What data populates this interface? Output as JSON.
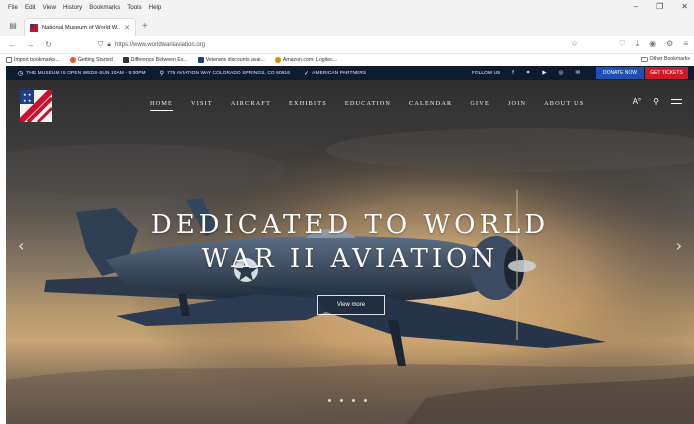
{
  "browser": {
    "menu": [
      "File",
      "Edit",
      "View",
      "History",
      "Bookmarks",
      "Tools",
      "Help"
    ],
    "window_controls": [
      "–",
      "❐",
      "✕"
    ],
    "tab_title": "National Museum of World W...",
    "url": "https://www.worldwariiaviation.org",
    "bookmarks": [
      {
        "label": "Import bookmarks...",
        "color": "#777777"
      },
      {
        "label": "Getting Started",
        "color": "#e8562a"
      },
      {
        "label": "Difference Between Ex...",
        "color": "#333333"
      },
      {
        "label": "Veterans discounts avai...",
        "color": "#1d3f8a"
      },
      {
        "label": "Amazon.com: Logitec...",
        "color": "#e08a00"
      }
    ],
    "other_bookmarks": "Other Bookmarks"
  },
  "site": {
    "info": {
      "hours": "THE MUSEUM IS OPEN WEDS-SUN 10AM - 5:00PM",
      "address": "775 AVIATION WAY COLORADO SPRINGS, CO 80916",
      "affiliate": "AMERICAN PARTNERS",
      "follow": "FOLLOW US",
      "social_icons": [
        "facebook-icon",
        "twitter-icon",
        "youtube-icon",
        "instagram-icon",
        "email-icon"
      ],
      "donate": "DONATE NOW",
      "tickets": "GET TICKETS"
    },
    "nav": [
      "HOME",
      "VISIT",
      "AIRCRAFT",
      "EXHIBITS",
      "EDUCATION",
      "CALENDAR",
      "GIVE",
      "JOIN",
      "ABOUT US"
    ],
    "hero": {
      "line1": "DEDICATED TO WORLD",
      "line2": "WAR II AVIATION",
      "button": "View more",
      "slides": 4
    }
  },
  "colors": {
    "infobar": "#0d1b2e",
    "donate": "#1f4fb5",
    "tickets": "#d0182b"
  }
}
